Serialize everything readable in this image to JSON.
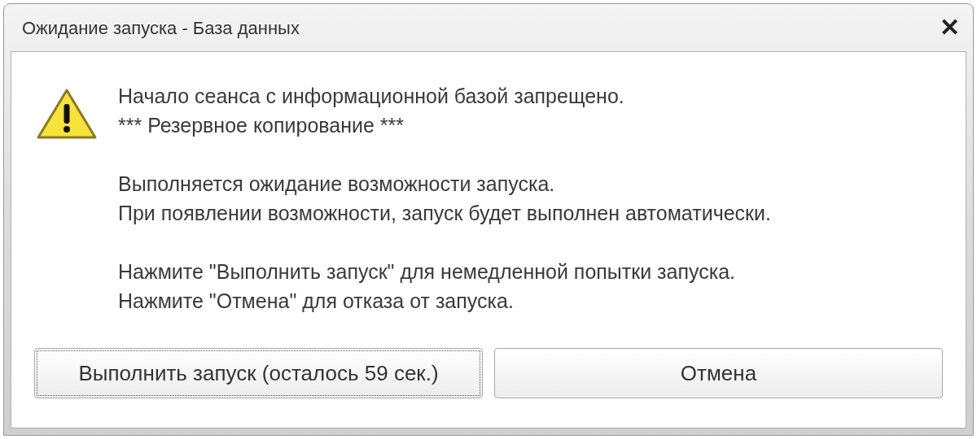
{
  "window": {
    "title": "Ожидание запуска - База данных",
    "close": "✕"
  },
  "message": {
    "paragraphs": [
      {
        "lines": [
          "Начало сеанса с информационной базой запрещено.",
          "*** Резервное копирование ***"
        ]
      },
      {
        "lines": [
          "Выполняется ожидание возможности запуска.",
          "При появлении возможности, запуск будет выполнен автоматически."
        ]
      },
      {
        "lines": [
          "Нажмите \"Выполнить запуск\" для немедленной попытки запуска.",
          "Нажмите \"Отмена\" для отказа от запуска."
        ]
      }
    ]
  },
  "buttons": [
    {
      "label": "Выполнить запуск (осталось 59 сек.)",
      "focused": true
    },
    {
      "label": "Отмена",
      "focused": false
    }
  ]
}
